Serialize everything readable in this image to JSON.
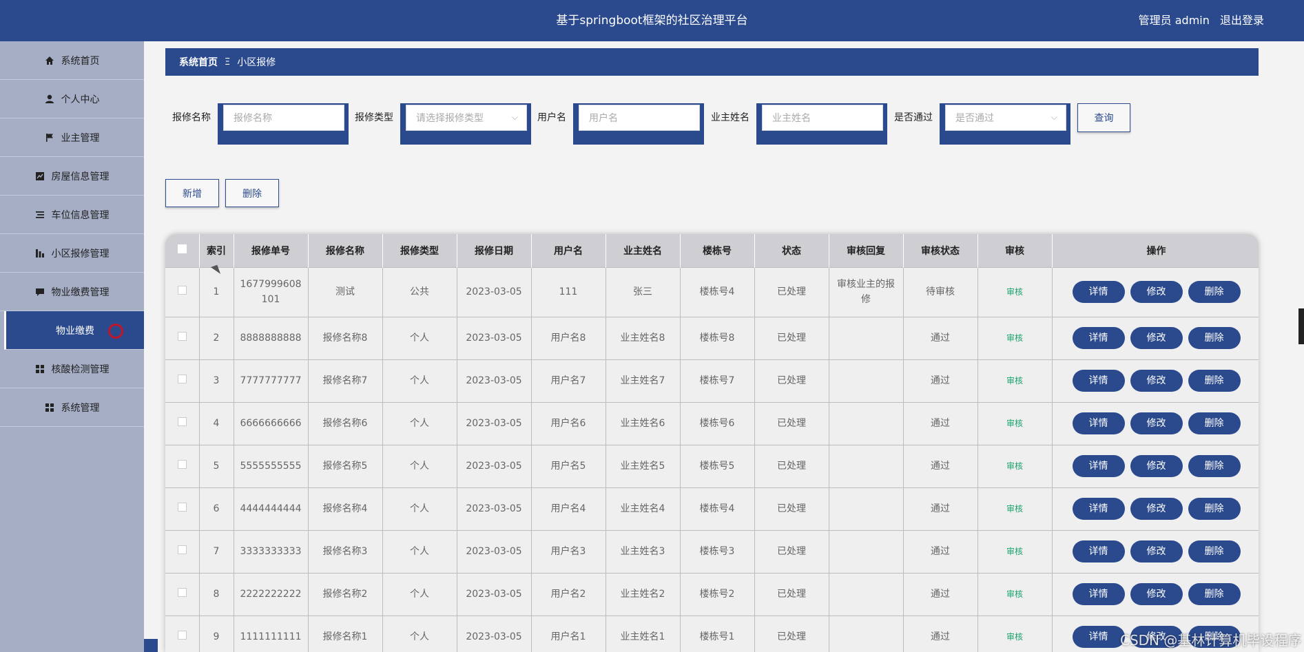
{
  "header": {
    "title": "基于springboot框架的社区治理平台",
    "role": "管理员 admin",
    "logout": "退出登录"
  },
  "sidebar": {
    "items": [
      {
        "label": "系统首页",
        "icon": "home-icon"
      },
      {
        "label": "个人中心",
        "icon": "user-icon"
      },
      {
        "label": "业主管理",
        "icon": "flag-icon"
      },
      {
        "label": "房屋信息管理",
        "icon": "chart-icon"
      },
      {
        "label": "车位信息管理",
        "icon": "list-icon"
      },
      {
        "label": "小区报修管理",
        "icon": "bar-icon"
      },
      {
        "label": "物业缴费管理",
        "icon": "comment-icon"
      },
      {
        "label": "物业缴费",
        "icon": ""
      },
      {
        "label": "核酸检测管理",
        "icon": "grid-icon"
      },
      {
        "label": "系统管理",
        "icon": "grid-icon"
      }
    ]
  },
  "breadcrumb": {
    "home": "系统首页",
    "sep": "Ξ",
    "current": "小区报修"
  },
  "filters": {
    "name_label": "报修名称",
    "name_placeholder": "报修名称",
    "type_label": "报修类型",
    "type_placeholder": "请选择报修类型",
    "user_label": "用户名",
    "user_placeholder": "用户名",
    "owner_label": "业主姓名",
    "owner_placeholder": "业主姓名",
    "pass_label": "是否通过",
    "pass_placeholder": "是否通过",
    "query": "查询"
  },
  "actions": {
    "add": "新增",
    "delete": "删除"
  },
  "table": {
    "headers": [
      "索引",
      "报修单号",
      "报修名称",
      "报修类型",
      "报修日期",
      "用户名",
      "业主姓名",
      "楼栋号",
      "状态",
      "审核回复",
      "审核状态",
      "审核",
      "操作"
    ],
    "audit_label": "审核",
    "btn_detail": "详情",
    "btn_edit": "修改",
    "btn_delete": "删除",
    "rows": [
      {
        "idx": "1",
        "no": "1677999608101",
        "name": "测试",
        "type": "公共",
        "date": "2023-03-05",
        "user": "111",
        "owner": "张三",
        "building": "楼栋号4",
        "status": "已处理",
        "reply": "审核业主的报修",
        "audit_status": "待审核"
      },
      {
        "idx": "2",
        "no": "8888888888",
        "name": "报修名称8",
        "type": "个人",
        "date": "2023-03-05",
        "user": "用户名8",
        "owner": "业主姓名8",
        "building": "楼栋号8",
        "status": "已处理",
        "reply": "",
        "audit_status": "通过"
      },
      {
        "idx": "3",
        "no": "7777777777",
        "name": "报修名称7",
        "type": "个人",
        "date": "2023-03-05",
        "user": "用户名7",
        "owner": "业主姓名7",
        "building": "楼栋号7",
        "status": "已处理",
        "reply": "",
        "audit_status": "通过"
      },
      {
        "idx": "4",
        "no": "6666666666",
        "name": "报修名称6",
        "type": "个人",
        "date": "2023-03-05",
        "user": "用户名6",
        "owner": "业主姓名6",
        "building": "楼栋号6",
        "status": "已处理",
        "reply": "",
        "audit_status": "通过"
      },
      {
        "idx": "5",
        "no": "5555555555",
        "name": "报修名称5",
        "type": "个人",
        "date": "2023-03-05",
        "user": "用户名5",
        "owner": "业主姓名5",
        "building": "楼栋号5",
        "status": "已处理",
        "reply": "",
        "audit_status": "通过"
      },
      {
        "idx": "6",
        "no": "4444444444",
        "name": "报修名称4",
        "type": "个人",
        "date": "2023-03-05",
        "user": "用户名4",
        "owner": "业主姓名4",
        "building": "楼栋号4",
        "status": "已处理",
        "reply": "",
        "audit_status": "通过"
      },
      {
        "idx": "7",
        "no": "3333333333",
        "name": "报修名称3",
        "type": "个人",
        "date": "2023-03-05",
        "user": "用户名3",
        "owner": "业主姓名3",
        "building": "楼栋号3",
        "status": "已处理",
        "reply": "",
        "audit_status": "通过"
      },
      {
        "idx": "8",
        "no": "2222222222",
        "name": "报修名称2",
        "type": "个人",
        "date": "2023-03-05",
        "user": "用户名2",
        "owner": "业主姓名2",
        "building": "楼栋号2",
        "status": "已处理",
        "reply": "",
        "audit_status": "通过"
      },
      {
        "idx": "9",
        "no": "1111111111",
        "name": "报修名称1",
        "type": "个人",
        "date": "2023-03-05",
        "user": "用户名1",
        "owner": "业主姓名1",
        "building": "楼栋号1",
        "status": "已处理",
        "reply": "",
        "audit_status": "通过"
      }
    ]
  },
  "watermark": "CSDN @基林计算机毕设程序",
  "colors": {
    "primary": "#2b4a8e",
    "sidebar": "#a6aec6",
    "audit_link": "#1aa36b",
    "ring": "#c0162b"
  }
}
